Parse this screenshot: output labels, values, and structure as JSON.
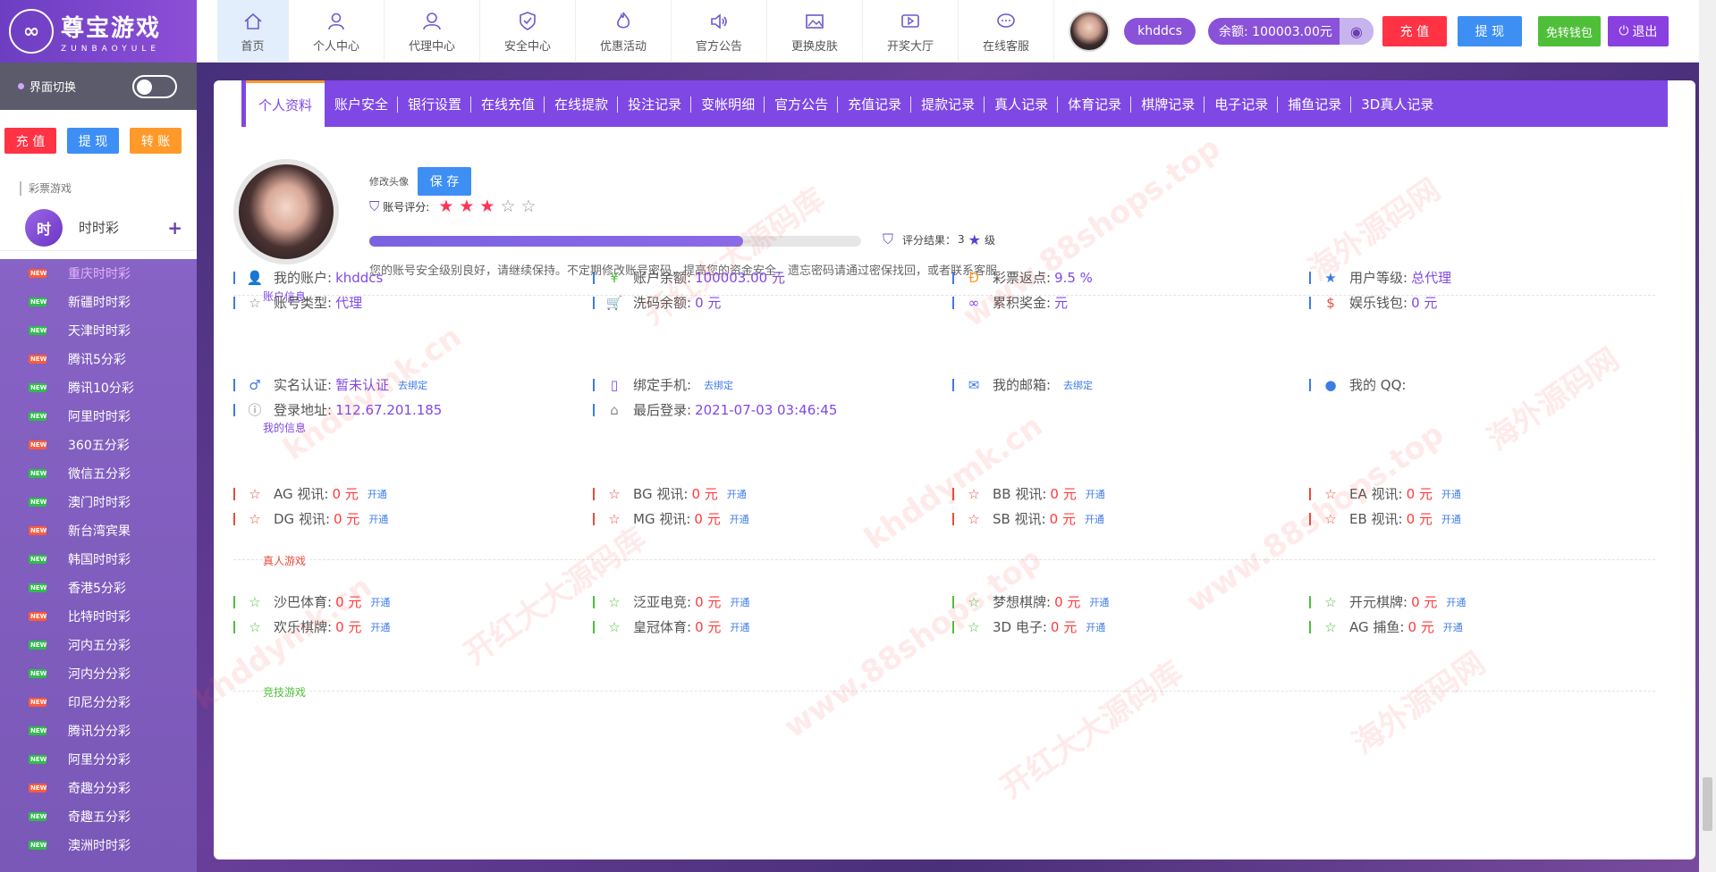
{
  "brand": {
    "name": "尊宝游戏",
    "sub": "ZUNBAOYULE",
    "mark": "∞"
  },
  "nav": [
    {
      "label": "首页",
      "icon": "home-icon"
    },
    {
      "label": "个人中心",
      "icon": "person-icon"
    },
    {
      "label": "代理中心",
      "icon": "agent-icon"
    },
    {
      "label": "安全中心",
      "icon": "shield-icon"
    },
    {
      "label": "优惠活动",
      "icon": "flame-icon"
    },
    {
      "label": "官方公告",
      "icon": "speaker-icon"
    },
    {
      "label": "更换皮肤",
      "icon": "image-icon"
    },
    {
      "label": "开奖大厅",
      "icon": "video-icon"
    },
    {
      "label": "在线客服",
      "icon": "chat-icon"
    }
  ],
  "user": {
    "name": "khddcs",
    "balance": "余额: 100003.00元"
  },
  "top_buttons": {
    "recharge": "充 值",
    "withdraw": "提 现",
    "free_wallet": "免转钱包",
    "logout": "退出"
  },
  "colors": {
    "purple": "#7f48e5",
    "red": "#ff3a3a",
    "blue": "#3d8ff4",
    "orange": "#ff9a2a",
    "green": "#4fbf3a"
  },
  "sidebar": {
    "theme_label": "界面切换",
    "btns": [
      "充 值",
      "提 现",
      "转 账"
    ],
    "category_label": "彩票游戏",
    "category": {
      "icon_text": "时",
      "label": "时时彩"
    },
    "games": [
      {
        "name": "重庆时时彩",
        "badge": "NEW",
        "current": true
      },
      {
        "name": "新疆时时彩",
        "badge": "NEW"
      },
      {
        "name": "天津时时彩",
        "badge": "NEW"
      },
      {
        "name": "腾讯5分彩",
        "badge": "NEW"
      },
      {
        "name": "腾讯10分彩",
        "badge": "NEW"
      },
      {
        "name": "阿里时时彩",
        "badge": "NEW"
      },
      {
        "name": "360五分彩",
        "badge": "NEW"
      },
      {
        "name": "微信五分彩",
        "badge": "NEW"
      },
      {
        "name": "澳门时时彩",
        "badge": "NEW"
      },
      {
        "name": "新台湾宾果",
        "badge": "NEW"
      },
      {
        "name": "韩国时时彩",
        "badge": "NEW"
      },
      {
        "name": "香港5分彩",
        "badge": "NEW"
      },
      {
        "name": "比特时时彩",
        "badge": "NEW"
      },
      {
        "name": "河内五分彩",
        "badge": "NEW"
      },
      {
        "name": "河内分分彩",
        "badge": "NEW"
      },
      {
        "name": "印尼分分彩",
        "badge": "NEW"
      },
      {
        "name": "腾讯分分彩",
        "badge": "NEW"
      },
      {
        "name": "阿里分分彩",
        "badge": "NEW"
      },
      {
        "name": "奇趣分分彩",
        "badge": "NEW"
      },
      {
        "name": "奇趣五分彩",
        "badge": "NEW"
      },
      {
        "name": "澳洲时时彩",
        "badge": "NEW"
      }
    ]
  },
  "tabs": [
    "个人资料",
    "账户安全",
    "银行设置",
    "在线充值",
    "在线提款",
    "投注记录",
    "变帐明细",
    "官方公告",
    "充值记录",
    "提款记录",
    "真人记录",
    "体育记录",
    "棋牌记录",
    "电子记录",
    "捕鱼记录",
    "3D真人记录"
  ],
  "profile": {
    "edit_label": "修改头像",
    "save": "保 存",
    "rating_label": "账号评分:",
    "rating": 3,
    "rating_max": 5,
    "security_progress": 0.76,
    "result_label": "评分结果：",
    "result_value": "3",
    "result_unit": "级",
    "hint": "您的账号安全级别良好，请继续保持。不定期修改账号密码，提高您的资金安全，遗忘密码请通过密保找回，或者联系客服"
  },
  "sections": {
    "account": "账户信息",
    "mine": "我的信息",
    "live": "真人游戏",
    "sports": "竞技游戏"
  },
  "account_info": [
    {
      "label": "我的账户:",
      "value": "khddcs",
      "icon": "user-icon"
    },
    {
      "label": "账户余额:",
      "value": "100003.00 元",
      "icon": "yen-icon"
    },
    {
      "label": "彩票返点:",
      "value": "9.5 %",
      "icon": "coin-icon"
    },
    {
      "label": "用户等级:",
      "value": "总代理",
      "icon": "star-badge-icon"
    },
    {
      "label": "账号类型:",
      "value": "代理",
      "icon": "star-outline-icon"
    },
    {
      "label": "洗码余额:",
      "value": "0 元",
      "icon": "cart-icon"
    },
    {
      "label": "累积奖金:",
      "value": "元",
      "icon": "infinity-icon"
    },
    {
      "label": "娱乐钱包:",
      "value": "0 元",
      "icon": "dollar-icon"
    }
  ],
  "my_info": [
    {
      "label": "实名认证:",
      "value": "暂未认证",
      "link": "去绑定",
      "icon": "male-icon"
    },
    {
      "label": "绑定手机:",
      "value": "",
      "link": "去绑定",
      "icon": "phone-icon"
    },
    {
      "label": "我的邮箱:",
      "value": "",
      "link": "去绑定",
      "icon": "mail-icon"
    },
    {
      "label": "我的 QQ:",
      "value": "",
      "link": "",
      "icon": "qq-icon"
    },
    {
      "label": "登录地址:",
      "value": "112.67.201.185",
      "icon": "info-icon"
    },
    {
      "label": "最后登录:",
      "value": "2021-07-03 03:46:45",
      "icon": "tag-icon"
    }
  ],
  "live_games": [
    {
      "label": "AG 视讯:",
      "value": "0 元",
      "link": "开通"
    },
    {
      "label": "BG 视讯:",
      "value": "0 元",
      "link": "开通"
    },
    {
      "label": "BB 视讯:",
      "value": "0 元",
      "link": "开通"
    },
    {
      "label": "EA 视讯:",
      "value": "0 元",
      "link": "开通"
    },
    {
      "label": "DG 视讯:",
      "value": "0 元",
      "link": "开通"
    },
    {
      "label": "MG 视讯:",
      "value": "0 元",
      "link": "开通"
    },
    {
      "label": "SB 视讯:",
      "value": "0 元",
      "link": "开通"
    },
    {
      "label": "EB 视讯:",
      "value": "0 元",
      "link": "开通"
    }
  ],
  "sport_games": [
    {
      "label": "沙巴体育:",
      "value": "0 元",
      "link": "开通"
    },
    {
      "label": "泛亚电竞:",
      "value": "0 元",
      "link": "开通"
    },
    {
      "label": "梦想棋牌:",
      "value": "0 元",
      "link": "开通"
    },
    {
      "label": "开元棋牌:",
      "value": "0 元",
      "link": "开通"
    },
    {
      "label": "欢乐棋牌:",
      "value": "0 元",
      "link": "开通"
    },
    {
      "label": "皇冠体育:",
      "value": "0 元",
      "link": "开通"
    },
    {
      "label": "3D 电子:",
      "value": "0 元",
      "link": "开通"
    },
    {
      "label": "AG 捕鱼:",
      "value": "0 元",
      "link": "开通"
    }
  ],
  "watermarks": [
    "开红大大源码库",
    "khddymk.cn",
    "www.88shops.top",
    "海外源码网"
  ]
}
